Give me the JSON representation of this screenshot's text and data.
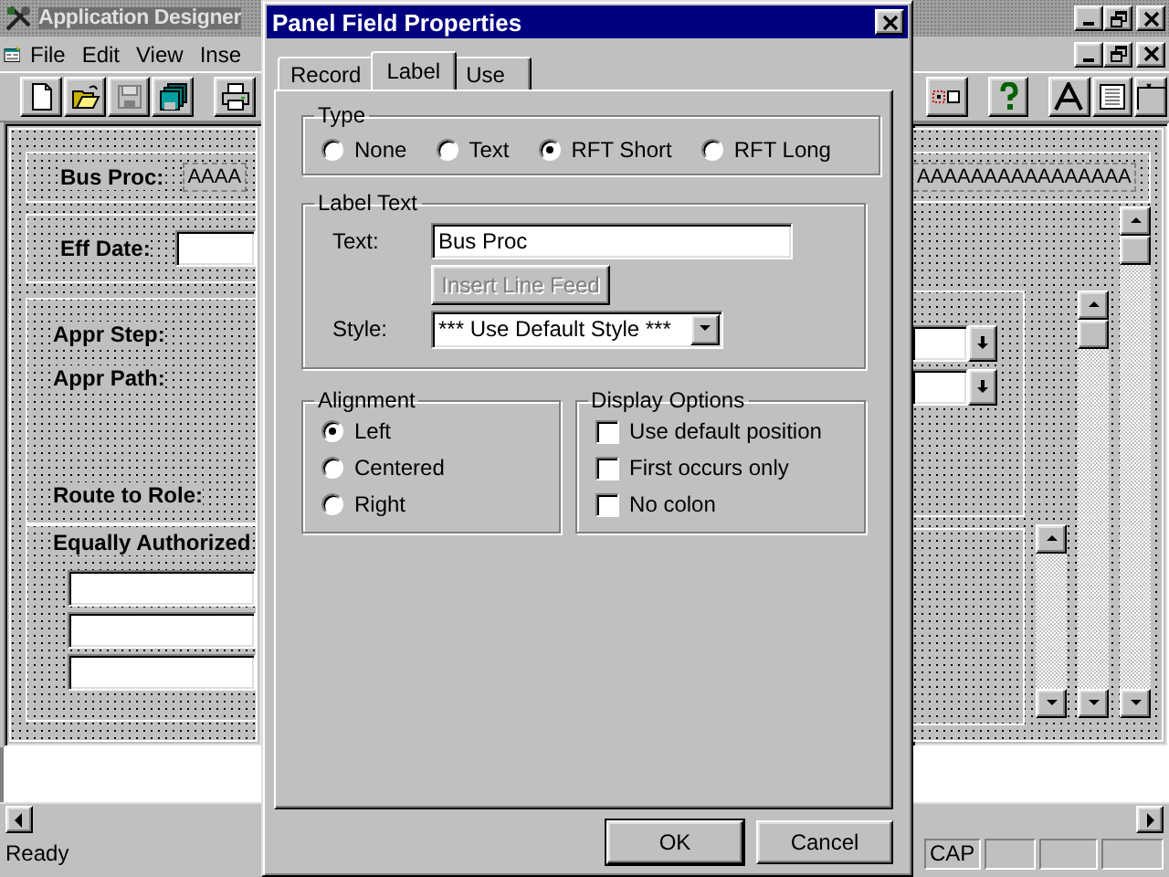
{
  "app": {
    "title": "Application Designer",
    "menu": [
      {
        "label": "File"
      },
      {
        "label": "Edit"
      },
      {
        "label": "View"
      },
      {
        "label": "Inse"
      }
    ],
    "status": "Ready",
    "indicator": "CAP"
  },
  "panel": {
    "bus_proc_label": "Bus Proc:",
    "bus_proc_value_left": "AAAA",
    "bus_proc_value_right": "AAAAAAAAAAAAAAAA",
    "eff_date_label": "Eff Date:",
    "labels": [
      "Appr Step:",
      "Appr Path:",
      "Route to Role:"
    ],
    "group_title": "Equally Authorized"
  },
  "dialog": {
    "title": "Panel Field Properties",
    "tabs": [
      {
        "label": "Record",
        "selected": false
      },
      {
        "label": "Label",
        "selected": true
      },
      {
        "label": "Use",
        "selected": false
      }
    ],
    "type": {
      "title": "Type",
      "options": [
        {
          "label": "None",
          "selected": false
        },
        {
          "label": "Text",
          "selected": false
        },
        {
          "label": "RFT Short",
          "selected": true
        },
        {
          "label": "RFT Long",
          "selected": false
        }
      ]
    },
    "label_text": {
      "title": "Label Text",
      "text_label": "Text:",
      "text_value": "Bus Proc",
      "insert_button": {
        "label": "Insert Line Feed",
        "disabled": true
      },
      "style_label": "Style:",
      "style_value": "*** Use Default Style ***"
    },
    "alignment": {
      "title": "Alignment",
      "options": [
        {
          "label": "Left",
          "selected": true
        },
        {
          "label": "Centered",
          "selected": false
        },
        {
          "label": "Right",
          "selected": false
        }
      ]
    },
    "display_options": {
      "title": "Display Options",
      "options": [
        {
          "label": "Use default position",
          "checked": false
        },
        {
          "label": "First occurs only",
          "checked": false
        },
        {
          "label": "No colon",
          "checked": false
        }
      ]
    },
    "buttons": [
      "OK",
      "Cancel"
    ]
  }
}
